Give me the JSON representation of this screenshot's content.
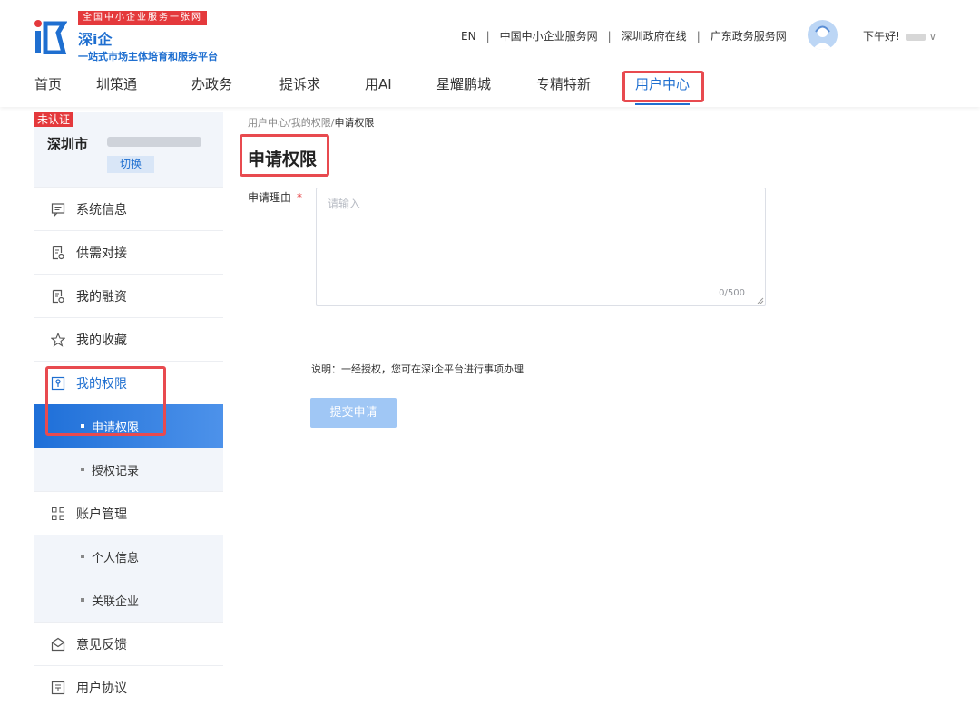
{
  "header": {
    "slogan": "全国中小企业服务一张网",
    "brand_name": "深i企",
    "brand_sub": "一站式市场主体培育和服务平台",
    "toplinks": [
      "EN",
      "中国中小企业服务网",
      "深圳政府在线",
      "广东政务服务网"
    ],
    "greeting": "下午好!",
    "nav": [
      "首页",
      "圳策通",
      "办政务",
      "提诉求",
      "用AI",
      "星耀鹏城",
      "专精特新",
      "用户中心"
    ],
    "active_nav": "用户中心"
  },
  "sidebar": {
    "badge": "未认证",
    "company_name": "深圳市",
    "switch_label": "切换",
    "menu": {
      "system_info": "系统信息",
      "supply_demand": "供需对接",
      "financing": "我的融资",
      "favorites": "我的收藏",
      "permissions": "我的权限",
      "apply_permission": "申请权限",
      "auth_records": "授权记录",
      "account": "账户管理",
      "personal_info": "个人信息",
      "linked_company": "关联企业",
      "feedback": "意见反馈",
      "agreement": "用户协议"
    }
  },
  "content": {
    "breadcrumb": {
      "part1": "用户中心",
      "part2": "我的权限",
      "current": "申请权限",
      "sep": "/"
    },
    "title": "申请权限",
    "reason_label": "申请理由",
    "required_mark": "*",
    "reason_placeholder": "请输入",
    "counter": "0/500",
    "note": "说明：一经授权，您可在深i企平台进行事项办理",
    "submit_label": "提交申请"
  },
  "colors": {
    "accent": "#1f6fd0",
    "badge": "#e4393c",
    "highlight": "#e84a4f"
  }
}
